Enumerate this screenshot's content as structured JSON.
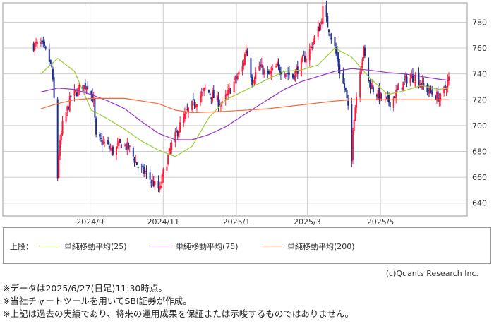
{
  "chart_data": {
    "type": "candlestick",
    "ylim": [
      630,
      795
    ],
    "yticks": [
      640,
      660,
      680,
      700,
      720,
      740,
      760,
      780
    ],
    "x_month_labels": [
      "2024/9",
      "2024/11",
      "2025/1",
      "2025/3",
      "2025/5"
    ],
    "up_color": "#ff1a3c",
    "down_color": "#1f2e8a",
    "ohlc_anchors": [
      {
        "d": "2024-07-16",
        "c": 762
      },
      {
        "d": "2024-07-22",
        "c": 763
      },
      {
        "d": "2024-07-26",
        "c": 757
      },
      {
        "d": "2024-07-31",
        "c": 745
      },
      {
        "d": "2024-08-02",
        "c": 720
      },
      {
        "d": "2024-08-05",
        "c": 660
      },
      {
        "d": "2024-08-06",
        "c": 678
      },
      {
        "d": "2024-08-09",
        "c": 700
      },
      {
        "d": "2024-08-16",
        "c": 722
      },
      {
        "d": "2024-08-23",
        "c": 728
      },
      {
        "d": "2024-08-30",
        "c": 732
      },
      {
        "d": "2024-09-04",
        "c": 718
      },
      {
        "d": "2024-09-06",
        "c": 690
      },
      {
        "d": "2024-09-13",
        "c": 686
      },
      {
        "d": "2024-09-20",
        "c": 680
      },
      {
        "d": "2024-09-27",
        "c": 686
      },
      {
        "d": "2024-10-04",
        "c": 682
      },
      {
        "d": "2024-10-11",
        "c": 668
      },
      {
        "d": "2024-10-18",
        "c": 662
      },
      {
        "d": "2024-10-25",
        "c": 654
      },
      {
        "d": "2024-10-29",
        "c": 650
      },
      {
        "d": "2024-11-01",
        "c": 663
      },
      {
        "d": "2024-11-08",
        "c": 685
      },
      {
        "d": "2024-11-15",
        "c": 700
      },
      {
        "d": "2024-11-22",
        "c": 712
      },
      {
        "d": "2024-11-29",
        "c": 720
      },
      {
        "d": "2024-12-06",
        "c": 728
      },
      {
        "d": "2024-12-13",
        "c": 722
      },
      {
        "d": "2024-12-20",
        "c": 716
      },
      {
        "d": "2024-12-25",
        "c": 725
      },
      {
        "d": "2025-01-06",
        "c": 745
      },
      {
        "d": "2025-01-09",
        "c": 760
      },
      {
        "d": "2025-01-14",
        "c": 735
      },
      {
        "d": "2025-01-20",
        "c": 746
      },
      {
        "d": "2025-01-27",
        "c": 738
      },
      {
        "d": "2025-02-03",
        "c": 745
      },
      {
        "d": "2025-02-10",
        "c": 742
      },
      {
        "d": "2025-02-17",
        "c": 738
      },
      {
        "d": "2025-02-24",
        "c": 748
      },
      {
        "d": "2025-03-03",
        "c": 758
      },
      {
        "d": "2025-03-07",
        "c": 768
      },
      {
        "d": "2025-03-12",
        "c": 778
      },
      {
        "d": "2025-03-14",
        "c": 790
      },
      {
        "d": "2025-03-19",
        "c": 775
      },
      {
        "d": "2025-03-24",
        "c": 760
      },
      {
        "d": "2025-03-28",
        "c": 742
      },
      {
        "d": "2025-04-02",
        "c": 726
      },
      {
        "d": "2025-04-04",
        "c": 712
      },
      {
        "d": "2025-04-07",
        "c": 672
      },
      {
        "d": "2025-04-08",
        "c": 700
      },
      {
        "d": "2025-04-10",
        "c": 715
      },
      {
        "d": "2025-04-14",
        "c": 745
      },
      {
        "d": "2025-04-17",
        "c": 758
      },
      {
        "d": "2025-04-21",
        "c": 735
      },
      {
        "d": "2025-04-25",
        "c": 728
      },
      {
        "d": "2025-05-01",
        "c": 722
      },
      {
        "d": "2025-05-09",
        "c": 718
      },
      {
        "d": "2025-05-16",
        "c": 728
      },
      {
        "d": "2025-05-23",
        "c": 736
      },
      {
        "d": "2025-05-30",
        "c": 738
      },
      {
        "d": "2025-06-06",
        "c": 730
      },
      {
        "d": "2025-06-13",
        "c": 725
      },
      {
        "d": "2025-06-20",
        "c": 721
      },
      {
        "d": "2025-06-27",
        "c": 736
      }
    ],
    "series": [
      {
        "name": "単純移動平均(25)",
        "color": "#9acd32",
        "values": [
          {
            "d": "2024-07-22",
            "v": 740
          },
          {
            "d": "2024-08-05",
            "v": 752
          },
          {
            "d": "2024-08-19",
            "v": 742
          },
          {
            "d": "2024-09-02",
            "v": 712
          },
          {
            "d": "2024-09-16",
            "v": 705
          },
          {
            "d": "2024-09-30",
            "v": 697
          },
          {
            "d": "2024-10-14",
            "v": 688
          },
          {
            "d": "2024-10-28",
            "v": 681
          },
          {
            "d": "2024-11-11",
            "v": 676
          },
          {
            "d": "2024-11-25",
            "v": 684
          },
          {
            "d": "2024-12-09",
            "v": 706
          },
          {
            "d": "2024-12-23",
            "v": 720
          },
          {
            "d": "2025-01-10",
            "v": 728
          },
          {
            "d": "2025-01-27",
            "v": 736
          },
          {
            "d": "2025-02-10",
            "v": 742
          },
          {
            "d": "2025-02-24",
            "v": 743
          },
          {
            "d": "2025-03-10",
            "v": 747
          },
          {
            "d": "2025-03-24",
            "v": 760
          },
          {
            "d": "2025-04-07",
            "v": 753
          },
          {
            "d": "2025-04-21",
            "v": 738
          },
          {
            "d": "2025-05-07",
            "v": 724
          },
          {
            "d": "2025-05-21",
            "v": 727
          },
          {
            "d": "2025-06-04",
            "v": 731
          },
          {
            "d": "2025-06-18",
            "v": 728
          },
          {
            "d": "2025-06-27",
            "v": 729
          }
        ]
      },
      {
        "name": "単純移動平均(75)",
        "color": "#9932cc",
        "values": [
          {
            "d": "2024-07-22",
            "v": 726
          },
          {
            "d": "2024-08-05",
            "v": 729
          },
          {
            "d": "2024-08-19",
            "v": 728
          },
          {
            "d": "2024-09-02",
            "v": 724
          },
          {
            "d": "2024-09-16",
            "v": 719
          },
          {
            "d": "2024-09-30",
            "v": 713
          },
          {
            "d": "2024-10-14",
            "v": 703
          },
          {
            "d": "2024-10-28",
            "v": 694
          },
          {
            "d": "2024-11-11",
            "v": 689
          },
          {
            "d": "2024-11-25",
            "v": 689
          },
          {
            "d": "2024-12-09",
            "v": 693
          },
          {
            "d": "2024-12-23",
            "v": 699
          },
          {
            "d": "2025-01-10",
            "v": 710
          },
          {
            "d": "2025-01-27",
            "v": 720
          },
          {
            "d": "2025-02-10",
            "v": 728
          },
          {
            "d": "2025-02-24",
            "v": 734
          },
          {
            "d": "2025-03-10",
            "v": 738
          },
          {
            "d": "2025-03-24",
            "v": 742
          },
          {
            "d": "2025-04-07",
            "v": 744
          },
          {
            "d": "2025-04-21",
            "v": 743
          },
          {
            "d": "2025-05-07",
            "v": 741
          },
          {
            "d": "2025-05-21",
            "v": 740
          },
          {
            "d": "2025-06-04",
            "v": 738
          },
          {
            "d": "2025-06-18",
            "v": 736
          },
          {
            "d": "2025-06-27",
            "v": 735
          }
        ]
      },
      {
        "name": "単純移動平均(200)",
        "color": "#ff6633",
        "values": [
          {
            "d": "2024-07-22",
            "v": 713
          },
          {
            "d": "2024-08-05",
            "v": 717
          },
          {
            "d": "2024-08-19",
            "v": 720
          },
          {
            "d": "2024-09-02",
            "v": 721
          },
          {
            "d": "2024-09-30",
            "v": 721
          },
          {
            "d": "2024-10-28",
            "v": 717
          },
          {
            "d": "2024-11-11",
            "v": 712
          },
          {
            "d": "2024-11-25",
            "v": 710
          },
          {
            "d": "2024-12-23",
            "v": 711
          },
          {
            "d": "2025-01-27",
            "v": 713
          },
          {
            "d": "2025-02-24",
            "v": 716
          },
          {
            "d": "2025-03-24",
            "v": 719
          },
          {
            "d": "2025-04-07",
            "v": 720
          },
          {
            "d": "2025-05-07",
            "v": 720
          },
          {
            "d": "2025-06-04",
            "v": 720
          },
          {
            "d": "2025-06-27",
            "v": 720
          }
        ]
      }
    ]
  },
  "legend": {
    "label": "上段：",
    "items": [
      "単純移動平均(25)",
      "単純移動平均(75)",
      "単純移動平均(200)"
    ]
  },
  "credit": "(c)Quants Research Inc.",
  "notes": [
    "※データは2025/6/27(日足)11:30時点。",
    "※当社チャートツールを用いてSBI証券が作成。",
    "※上記は過去の実績であり、将来の運用成果を保証または示唆するものではありません。"
  ]
}
